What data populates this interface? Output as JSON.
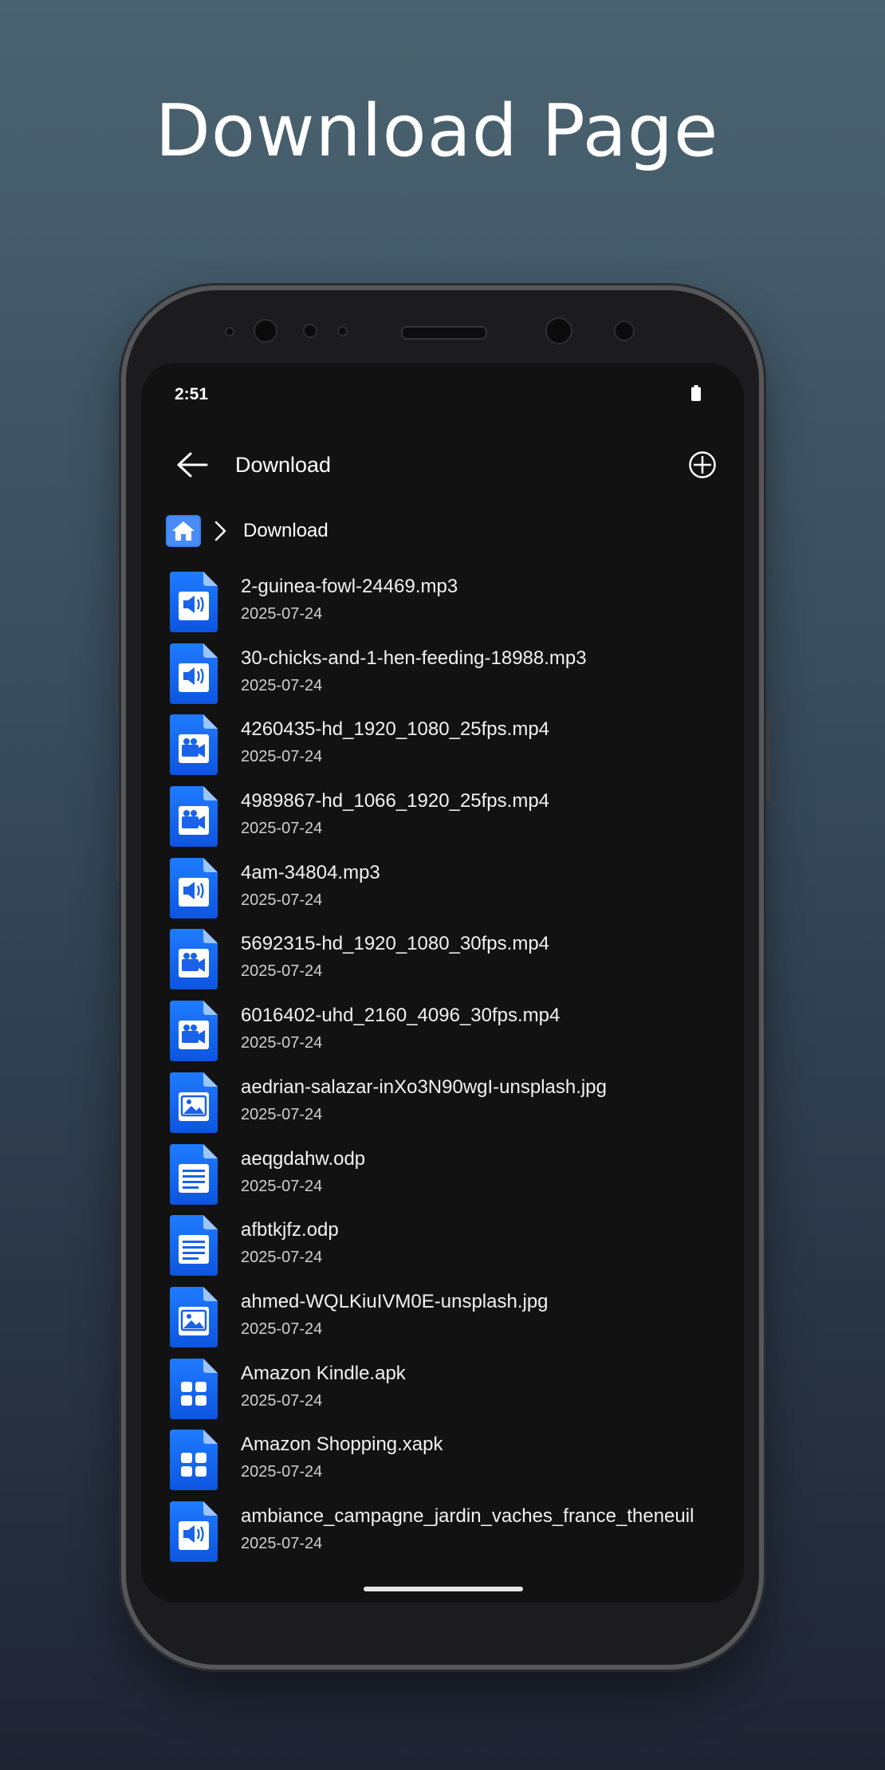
{
  "promo": {
    "title": "Download Page"
  },
  "status_bar": {
    "time": "2:51",
    "battery_icon": "battery-full-icon"
  },
  "app_bar": {
    "title": "Download",
    "back_icon": "arrow-left-icon",
    "add_icon": "circle-plus-icon"
  },
  "breadcrumb": {
    "home_icon": "home-icon",
    "current": "Download"
  },
  "files": [
    {
      "name": "2-guinea-fowl-24469.mp3",
      "date": "2025-07-24",
      "type": "audio"
    },
    {
      "name": "30-chicks-and-1-hen-feeding-18988.mp3",
      "date": "2025-07-24",
      "type": "audio"
    },
    {
      "name": "4260435-hd_1920_1080_25fps.mp4",
      "date": "2025-07-24",
      "type": "video"
    },
    {
      "name": "4989867-hd_1066_1920_25fps.mp4",
      "date": "2025-07-24",
      "type": "video"
    },
    {
      "name": "4am-34804.mp3",
      "date": "2025-07-24",
      "type": "audio"
    },
    {
      "name": "5692315-hd_1920_1080_30fps.mp4",
      "date": "2025-07-24",
      "type": "video"
    },
    {
      "name": "6016402-uhd_2160_4096_30fps.mp4",
      "date": "2025-07-24",
      "type": "video"
    },
    {
      "name": "aedrian-salazar-inXo3N90wgI-unsplash.jpg",
      "date": "2025-07-24",
      "type": "image"
    },
    {
      "name": "aeqgdahw.odp",
      "date": "2025-07-24",
      "type": "document"
    },
    {
      "name": "afbtkjfz.odp",
      "date": "2025-07-24",
      "type": "document"
    },
    {
      "name": "ahmed-WQLKiuIVM0E-unsplash.jpg",
      "date": "2025-07-24",
      "type": "image"
    },
    {
      "name": "Amazon Kindle.apk",
      "date": "2025-07-24",
      "type": "app"
    },
    {
      "name": "Amazon Shopping.xapk",
      "date": "2025-07-24",
      "type": "app"
    },
    {
      "name": "ambiance_campagne_jardin_vaches_france_theneuil",
      "date": "2025-07-24",
      "type": "audio"
    }
  ],
  "colors": {
    "file_icon_top": "#1f7bff",
    "file_icon_bottom": "#0d55e0",
    "screen_bg": "#121212"
  }
}
